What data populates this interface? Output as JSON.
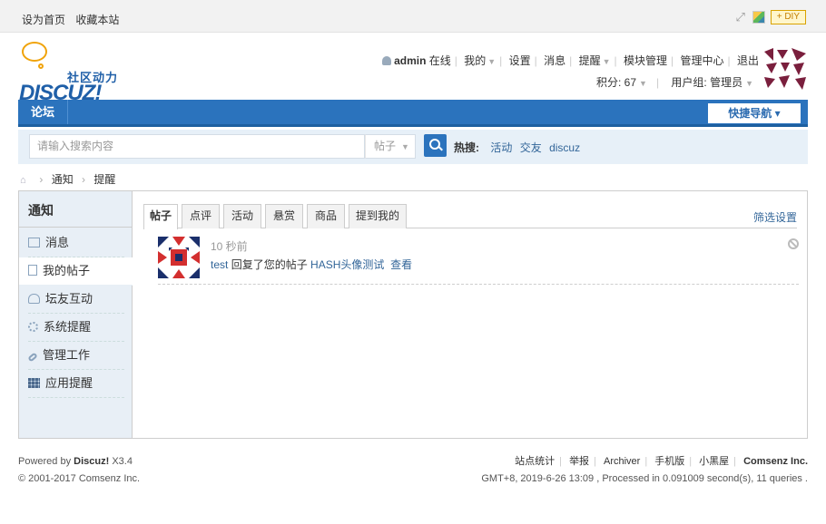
{
  "topbar": {
    "set_home": "设为首页",
    "bookmark": "收藏本站",
    "diy": "DIY"
  },
  "logo": {
    "tagline": "社区动力",
    "wordmark": "DISCUZ!"
  },
  "user": {
    "name": "admin",
    "status": "在线",
    "links": [
      "我的",
      "设置",
      "消息",
      "提醒",
      "模块管理",
      "管理中心",
      "退出"
    ],
    "credits": "积分: 67",
    "group": "用户组: 管理员"
  },
  "nav": {
    "forum": "论坛",
    "quick_nav": "快捷导航"
  },
  "search": {
    "placeholder": "请输入搜索内容",
    "type": "帖子",
    "hot_label": "热搜:",
    "hot": [
      "活动",
      "交友",
      "discuz"
    ]
  },
  "breadcrumb": [
    "通知",
    "提醒"
  ],
  "sidebar": {
    "title": "通知",
    "items": [
      "消息",
      "我的帖子",
      "坛友互动",
      "系统提醒",
      "管理工作",
      "应用提醒"
    ]
  },
  "tabs": [
    "帖子",
    "点评",
    "活动",
    "悬赏",
    "商品",
    "提到我的"
  ],
  "filter": "筛选设置",
  "notice": {
    "time": "10 秒前",
    "user": "test",
    "action": "回复了您的帖子",
    "post": "HASH头像测试",
    "view": "查看"
  },
  "footer": {
    "powered_pre": "Powered by",
    "powered_name": "Discuz!",
    "powered_ver": "X3.4",
    "copyright": "© 2001-2017 Comsenz Inc.",
    "links": [
      "站点统计",
      "举报",
      "Archiver",
      "手机版",
      "小黑屋"
    ],
    "company": "Comsenz Inc.",
    "stats": "GMT+8, 2019-6-26 13:09 , Processed in 0.091009 second(s), 11 queries ."
  },
  "colors": {
    "nav_blue": "#2b73bd",
    "link": "#336699",
    "logo_orange": "#f0a30a"
  }
}
